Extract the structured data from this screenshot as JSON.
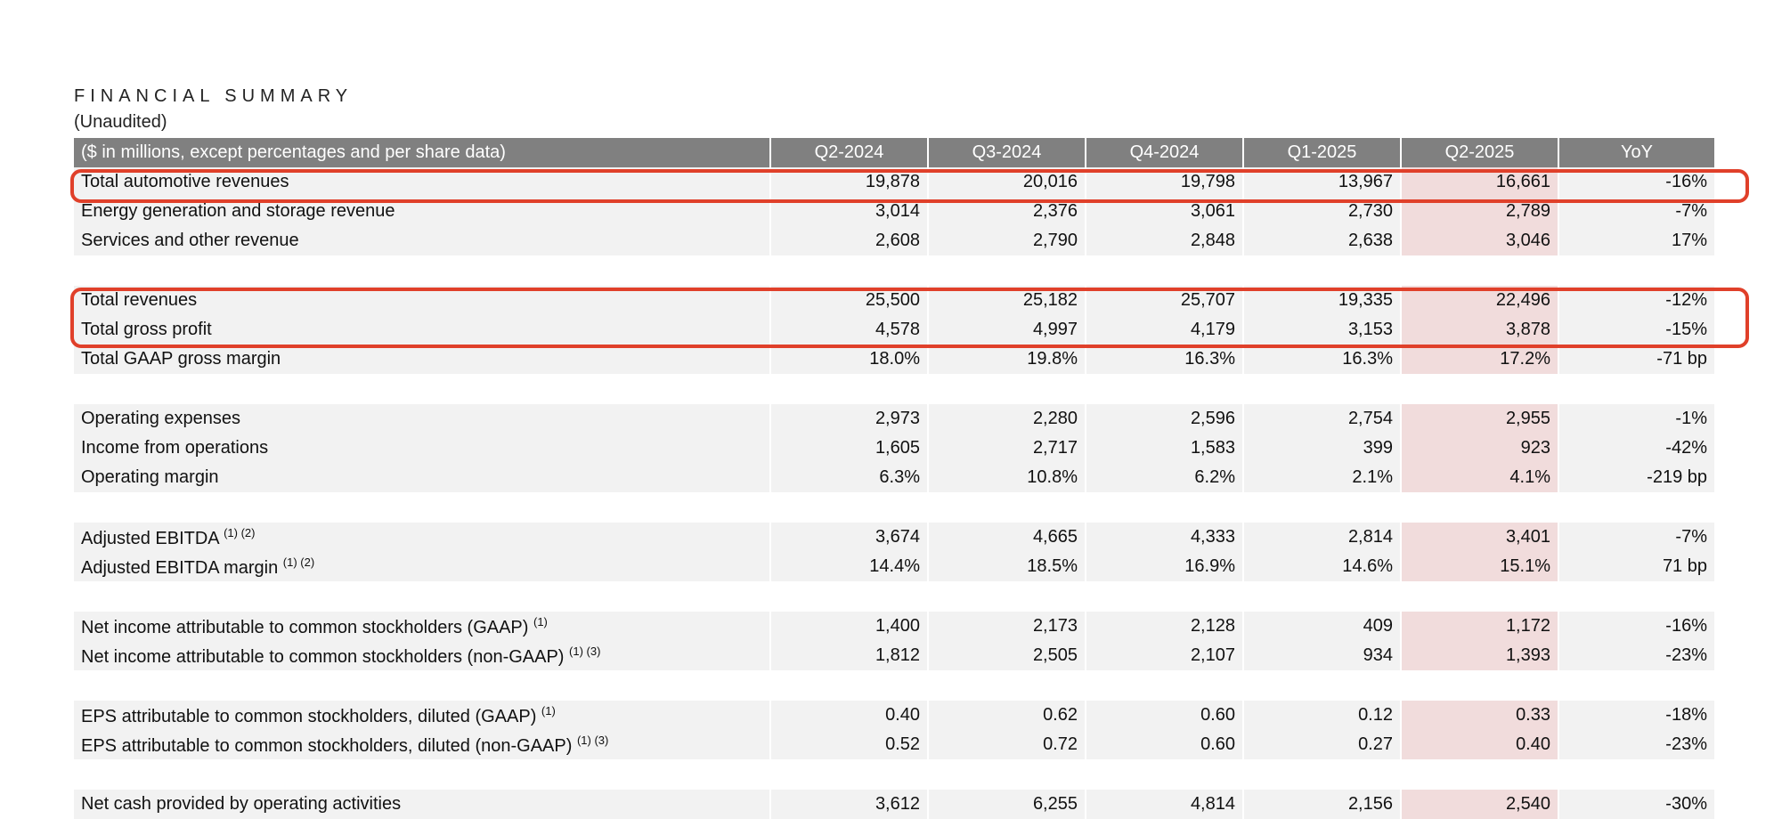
{
  "title": "FINANCIAL SUMMARY",
  "subtitle": "(Unaudited)",
  "header": [
    "($ in millions, except percentages and per share data)",
    "Q2-2024",
    "Q3-2024",
    "Q4-2024",
    "Q1-2025",
    "Q2-2025",
    "YoY"
  ],
  "colors": {
    "header_bg": "#808080",
    "row_bg": "#f2f2f2",
    "highlight_col_bg": "#f1dcdc",
    "annotation_box": "#e0402a"
  },
  "rows": [
    {
      "label": "Total automotive revenues",
      "sup": "",
      "values": [
        "19,878",
        "20,016",
        "19,798",
        "13,967",
        "16,661",
        "-16%"
      ]
    },
    {
      "label": "Energy generation and storage revenue",
      "sup": "",
      "values": [
        "3,014",
        "2,376",
        "3,061",
        "2,730",
        "2,789",
        "-7%"
      ]
    },
    {
      "label": "Services and other revenue",
      "sup": "",
      "values": [
        "2,608",
        "2,790",
        "2,848",
        "2,638",
        "3,046",
        "17%"
      ]
    },
    {
      "gap": true
    },
    {
      "label": "Total revenues",
      "sup": "",
      "values": [
        "25,500",
        "25,182",
        "25,707",
        "19,335",
        "22,496",
        "-12%"
      ]
    },
    {
      "label": "Total gross profit",
      "sup": "",
      "values": [
        "4,578",
        "4,997",
        "4,179",
        "3,153",
        "3,878",
        "-15%"
      ]
    },
    {
      "label": "Total GAAP gross margin",
      "sup": "",
      "values": [
        "18.0%",
        "19.8%",
        "16.3%",
        "16.3%",
        "17.2%",
        "-71 bp"
      ]
    },
    {
      "gap": true
    },
    {
      "label": "Operating expenses",
      "sup": "",
      "values": [
        "2,973",
        "2,280",
        "2,596",
        "2,754",
        "2,955",
        "-1%"
      ]
    },
    {
      "label": "Income from operations",
      "sup": "",
      "values": [
        "1,605",
        "2,717",
        "1,583",
        "399",
        "923",
        "-42%"
      ]
    },
    {
      "label": "Operating margin",
      "sup": "",
      "values": [
        "6.3%",
        "10.8%",
        "6.2%",
        "2.1%",
        "4.1%",
        "-219 bp"
      ]
    },
    {
      "gap": true
    },
    {
      "label": "Adjusted EBITDA",
      "sup": "(1) (2)",
      "values": [
        "3,674",
        "4,665",
        "4,333",
        "2,814",
        "3,401",
        "-7%"
      ]
    },
    {
      "label": "Adjusted EBITDA margin",
      "sup": "(1) (2)",
      "values": [
        "14.4%",
        "18.5%",
        "16.9%",
        "14.6%",
        "15.1%",
        "71 bp"
      ]
    },
    {
      "gap": true
    },
    {
      "label": "Net income attributable to common stockholders (GAAP)",
      "sup": "(1)",
      "values": [
        "1,400",
        "2,173",
        "2,128",
        "409",
        "1,172",
        "-16%"
      ]
    },
    {
      "label": "Net income attributable to common stockholders (non-GAAP)",
      "sup": "(1) (3)",
      "values": [
        "1,812",
        "2,505",
        "2,107",
        "934",
        "1,393",
        "-23%"
      ]
    },
    {
      "gap": true
    },
    {
      "label": "EPS attributable to common stockholders, diluted (GAAP)",
      "sup": "(1)",
      "values": [
        "0.40",
        "0.62",
        "0.60",
        "0.12",
        "0.33",
        "-18%"
      ]
    },
    {
      "label": "EPS attributable to common stockholders, diluted (non-GAAP)",
      "sup": "(1) (3)",
      "values": [
        "0.52",
        "0.72",
        "0.60",
        "0.27",
        "0.40",
        "-23%"
      ]
    },
    {
      "gap": true
    },
    {
      "label": "Net cash provided by operating activities",
      "sup": "",
      "values": [
        "3,612",
        "6,255",
        "4,814",
        "2,156",
        "2,540",
        "-30%"
      ]
    }
  ]
}
